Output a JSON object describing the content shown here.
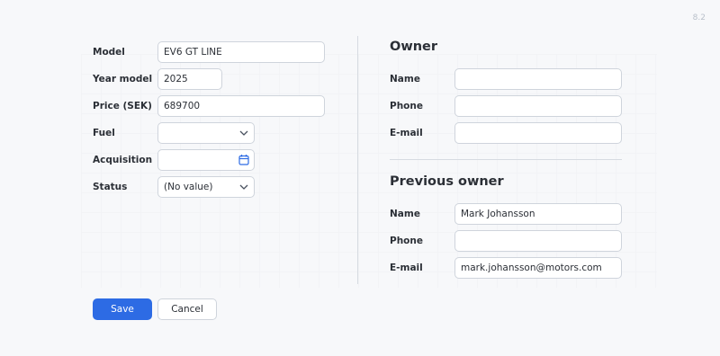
{
  "version": "8.2",
  "vehicle": {
    "model_label": "Model",
    "model_value": "EV6 GT LINE",
    "year_label": "Year model",
    "year_value": "2025",
    "price_label": "Price (SEK)",
    "price_value": "689700",
    "fuel_label": "Fuel",
    "fuel_value": "",
    "acquisition_label": "Acquisition",
    "acquisition_value": "",
    "status_label": "Status",
    "status_value": "(No value)"
  },
  "owner": {
    "title": "Owner",
    "name_label": "Name",
    "name_value": "",
    "phone_label": "Phone",
    "phone_value": "",
    "email_label": "E-mail",
    "email_value": ""
  },
  "previous_owner": {
    "title": "Previous owner",
    "name_label": "Name",
    "name_value": "Mark Johansson",
    "phone_label": "Phone",
    "phone_value": "",
    "email_label": "E-mail",
    "email_value": "mark.johansson@motors.com"
  },
  "actions": {
    "save_label": "Save",
    "cancel_label": "Cancel"
  },
  "colors": {
    "accent": "#2d6be4",
    "border": "#cfd4dc",
    "background": "#f7f8fa"
  },
  "icons": {
    "select": "chevron-down-icon",
    "date": "calendar-icon"
  }
}
